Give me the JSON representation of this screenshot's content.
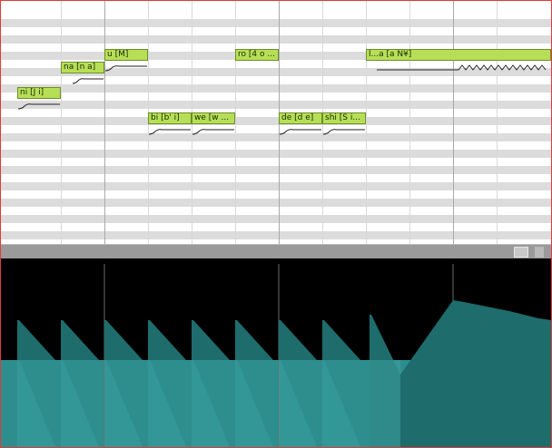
{
  "window": {
    "title": ""
  },
  "notes": [
    {
      "id": "n1",
      "label": "ni [J i]"
    },
    {
      "id": "n2",
      "label": "na [n a]"
    },
    {
      "id": "n3",
      "label": "u [M]"
    },
    {
      "id": "n4",
      "label": "bi [b' i]"
    },
    {
      "id": "n5",
      "label": "we [w ..."
    },
    {
      "id": "n6",
      "label": "ro [4 o ..."
    },
    {
      "id": "n7",
      "label": "de [d e]"
    },
    {
      "id": "n8",
      "label": "shi [S i..."
    },
    {
      "id": "n9",
      "label": "l...a [a N¥]"
    }
  ],
  "colors": {
    "note_fill": "#b6df57",
    "note_border": "#6e8f2b",
    "curve_fill": "#2e8e8e",
    "curve_fill_dark": "#1f6c6c",
    "graph_bg": "#000000",
    "frame_border": "#e23a3a"
  },
  "icons": {
    "scroll_thumb": "scroll-thumb-icon"
  }
}
